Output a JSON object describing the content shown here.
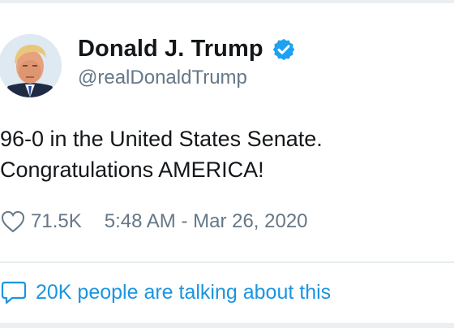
{
  "tweet": {
    "display_name": "Donald J. Trump",
    "handle": "@realDonaldTrump",
    "verified": true,
    "text_lines": [
      "96-0 in the United States Senate.",
      "Congratulations AMERICA!"
    ],
    "likes": "71.5K",
    "timestamp": "5:48 AM - Mar 26, 2020",
    "talking_label": "20K people are talking about this"
  },
  "icons": {
    "verified": "verified-badge-icon",
    "like": "heart-icon",
    "reply": "speech-bubble-icon",
    "avatar": "profile-photo"
  },
  "colors": {
    "brand_blue": "#1da1f2",
    "link_blue": "#1b95e0",
    "text": "#14171a",
    "muted": "#657786"
  }
}
